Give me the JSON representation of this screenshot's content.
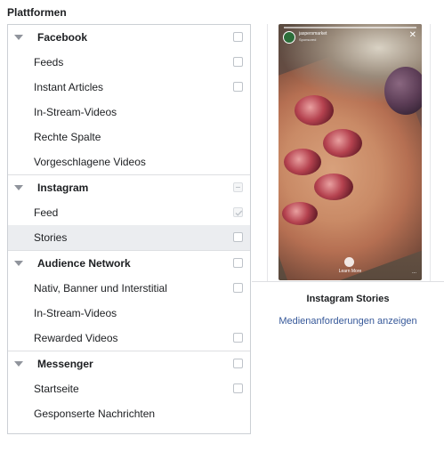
{
  "title": "Plattformen",
  "groups": [
    {
      "name": "Facebook",
      "checked": false,
      "items": [
        {
          "label": "Feeds",
          "checkbox": true
        },
        {
          "label": "Instant Articles",
          "checkbox": true
        },
        {
          "label": "In-Stream-Videos",
          "checkbox": false
        },
        {
          "label": "Rechte Spalte",
          "checkbox": false
        },
        {
          "label": "Vorgeschlagene Videos",
          "checkbox": false
        }
      ]
    },
    {
      "name": "Instagram",
      "checked": "partial",
      "items": [
        {
          "label": "Feed",
          "checkbox": true,
          "checked": true
        },
        {
          "label": "Stories",
          "checkbox": true,
          "selected": true
        }
      ]
    },
    {
      "name": "Audience Network",
      "checked": false,
      "items": [
        {
          "label": "Nativ, Banner und Interstitial",
          "checkbox": true
        },
        {
          "label": "In-Stream-Videos",
          "checkbox": false
        },
        {
          "label": "Rewarded Videos",
          "checkbox": true
        }
      ]
    },
    {
      "name": "Messenger",
      "checked": false,
      "items": [
        {
          "label": "Startseite",
          "checkbox": true
        },
        {
          "label": "Gesponserte Nachrichten",
          "checkbox": false
        }
      ]
    }
  ],
  "preview": {
    "story_user": "jaspersmarket",
    "story_sponsored": "Sponsored",
    "close_icon": "close-icon",
    "cta": "Learn More",
    "dots": "...",
    "title": "Instagram Stories",
    "link": "Medienanforderungen anzeigen"
  },
  "colors": {
    "link": "#365899",
    "selected_row": "#ebedf0",
    "border": "#ccd0d5"
  }
}
